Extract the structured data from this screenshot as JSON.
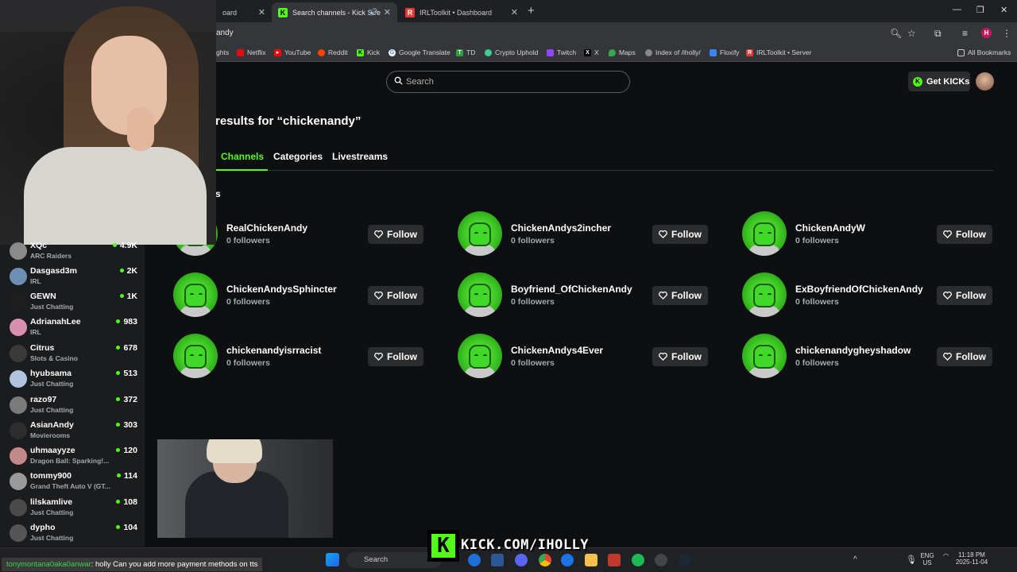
{
  "browser": {
    "tabs": [
      {
        "label": "oard",
        "active": false
      },
      {
        "label": "Search channels - Kick Stre",
        "active": true
      },
      {
        "label": "IRLToolkit • Dashboard",
        "active": false
      }
    ],
    "url": "andy",
    "bookmarks": [
      "ghts",
      "Netflix",
      "YouTube",
      "Reddit",
      "Kick",
      "Google Translate",
      "TD",
      "Crypto Uphold",
      "Twitch",
      "X",
      "Maps",
      "Index of /iholly/",
      "Floxify",
      "IRLToolkit • Server"
    ],
    "all_bookmarks": "All Bookmarks",
    "profile_initial": "H"
  },
  "header": {
    "search_placeholder": "Search",
    "get_kicks": "Get KICKs"
  },
  "results": {
    "title": "results for “chickenandy”",
    "tabs": [
      "Channels",
      "Categories",
      "Livestreams"
    ],
    "section_fragment": "s",
    "follow_label": "Follow",
    "channels": [
      {
        "name": "RealChickenAndy",
        "followers": "0 followers"
      },
      {
        "name": "ChickenAndys2incher",
        "followers": "0 followers"
      },
      {
        "name": "ChickenAndyW",
        "followers": "0 followers"
      },
      {
        "name": "ChickenAndysSphincter",
        "followers": "0 followers"
      },
      {
        "name": "Boyfriend_OfChickenAndy",
        "followers": "0 followers"
      },
      {
        "name": "ExBoyfriendOfChickenAndy",
        "followers": "0 followers"
      },
      {
        "name": "chickenandyisrracist",
        "followers": "0 followers"
      },
      {
        "name": "ChickenAndys4Ever",
        "followers": "0 followers"
      },
      {
        "name": "chickenandygheyshadow",
        "followers": "0 followers"
      }
    ]
  },
  "followed": [
    {
      "name": "XQc",
      "category": "ARC Raiders",
      "viewers": "4.9K",
      "color": "#8a8a8a"
    },
    {
      "name": "Dasgasd3m",
      "category": "IRL",
      "viewers": "2K",
      "color": "#6d8fb3"
    },
    {
      "name": "GEWN",
      "category": "Just Chatting",
      "viewers": "1K",
      "color": "#1e1e1e"
    },
    {
      "name": "AdrianahLee",
      "category": "IRL",
      "viewers": "983",
      "color": "#d98fb0"
    },
    {
      "name": "Citrus",
      "category": "Slots & Casino",
      "viewers": "678",
      "color": "#3a3a3a"
    },
    {
      "name": "hyubsama",
      "category": "Just Chatting",
      "viewers": "513",
      "color": "#b0c4de"
    },
    {
      "name": "razo97",
      "category": "Just Chatting",
      "viewers": "372",
      "color": "#7a7a7a"
    },
    {
      "name": "AsianAndy",
      "category": "Movierooms",
      "viewers": "303",
      "color": "#2d2d2d"
    },
    {
      "name": "uhmaayyze",
      "category": "Dragon Ball: Sparking!...",
      "viewers": "120",
      "color": "#c48a8a"
    },
    {
      "name": "tommy900",
      "category": "Grand Theft Auto V (GT...",
      "viewers": "114",
      "color": "#9a9a9a"
    },
    {
      "name": "lilskamlive",
      "category": "Just Chatting",
      "viewers": "108",
      "color": "#4a4a4a"
    },
    {
      "name": "dypho",
      "category": "Just Chatting",
      "viewers": "104",
      "color": "#555555"
    }
  ],
  "overlay": {
    "kick_url": "KICK.COM/IHOLLY",
    "chat_user": "tonymontana0aka0anwar",
    "chat_message": ": holly Can you add more payment methods on tts"
  },
  "taskbar": {
    "search": "Search",
    "lang": "ENG",
    "region": "US",
    "time": "11:18 PM",
    "date": "2025-11-04"
  },
  "colors": {
    "kick_green": "#53fc18",
    "page_bg": "#0e0f10",
    "button_bg": "#2a2c2e"
  }
}
